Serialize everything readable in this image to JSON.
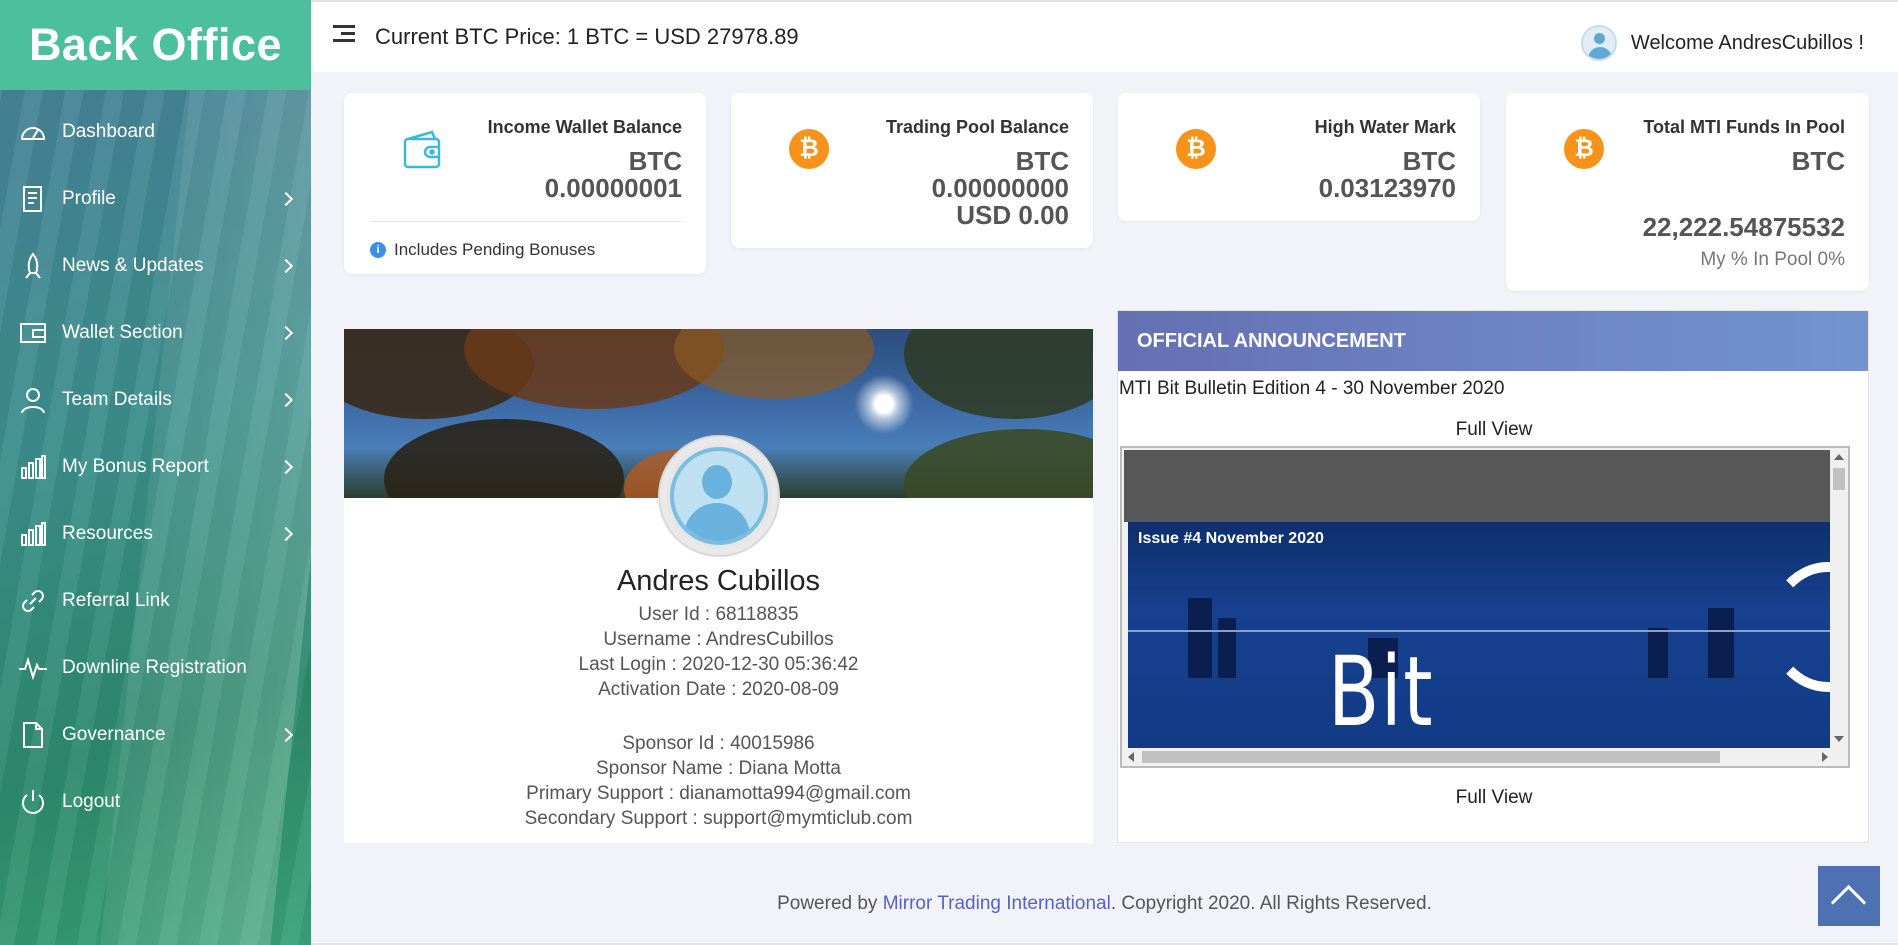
{
  "brand": "Back Office",
  "sidebar": {
    "items": [
      {
        "label": "Dashboard",
        "icon": "dashboard-icon"
      },
      {
        "label": "Profile",
        "icon": "profile-icon"
      },
      {
        "label": "News & Updates",
        "icon": "rocket-icon"
      },
      {
        "label": "Wallet Section",
        "icon": "wallet-icon"
      },
      {
        "label": "Team Details",
        "icon": "user-icon"
      },
      {
        "label": "My Bonus Report",
        "icon": "bar-chart-icon"
      },
      {
        "label": "Resources",
        "icon": "bar-chart-icon"
      },
      {
        "label": "Referral Link",
        "icon": "link-icon"
      },
      {
        "label": "Downline Registration",
        "icon": "pulse-icon"
      },
      {
        "label": "Governance",
        "icon": "document-icon"
      },
      {
        "label": "Logout",
        "icon": "power-icon"
      }
    ]
  },
  "header": {
    "btc_price": "Current BTC Price: 1 BTC = USD 27978.89",
    "welcome": "Welcome AndresCubillos !"
  },
  "stats": {
    "income": {
      "title": "Income Wallet Balance",
      "unit": "BTC",
      "value": "0.00000001",
      "note": "Includes Pending Bonuses"
    },
    "trading": {
      "title": "Trading Pool Balance",
      "unit": "BTC",
      "value": "0.00000000",
      "usd": "USD 0.00"
    },
    "hwm": {
      "title": "High Water Mark",
      "unit": "BTC",
      "value": "0.03123970"
    },
    "total": {
      "title": "Total MTI Funds In Pool",
      "unit": "BTC",
      "value": "22,222.54875532",
      "pct": "My % In Pool 0%"
    }
  },
  "profile": {
    "name": "Andres Cubillos",
    "user_id": "User Id : 68118835",
    "username": "Username : AndresCubillos",
    "last_login": "Last Login : 2020-12-30 05:36:42",
    "activation": "Activation Date : 2020-08-09",
    "sponsor_id": "Sponsor Id : 40015986",
    "sponsor_name": "Sponsor Name : Diana Motta",
    "primary_support": "Primary Support : dianamotta994@gmail.com",
    "secondary_support": "Secondary Support : support@mymticlub.com"
  },
  "announcement": {
    "heading": "OFFICIAL ANNOUNCEMENT",
    "title": "MTI Bit Bulletin Edition 4 - 30 November 2020",
    "full_view": "Full View",
    "issue": "Issue #4 November 2020",
    "banner_text": "Bit Bulletin"
  },
  "footer": {
    "prefix": "Powered by ",
    "link": "Mirror Trading International",
    "suffix": ". Copyright 2020. All Rights Reserved."
  },
  "colors": {
    "brand": "#4cbf9c",
    "bitcoin": "#f7931a",
    "announce_head": "#6f86c6",
    "link": "#5562c7"
  }
}
